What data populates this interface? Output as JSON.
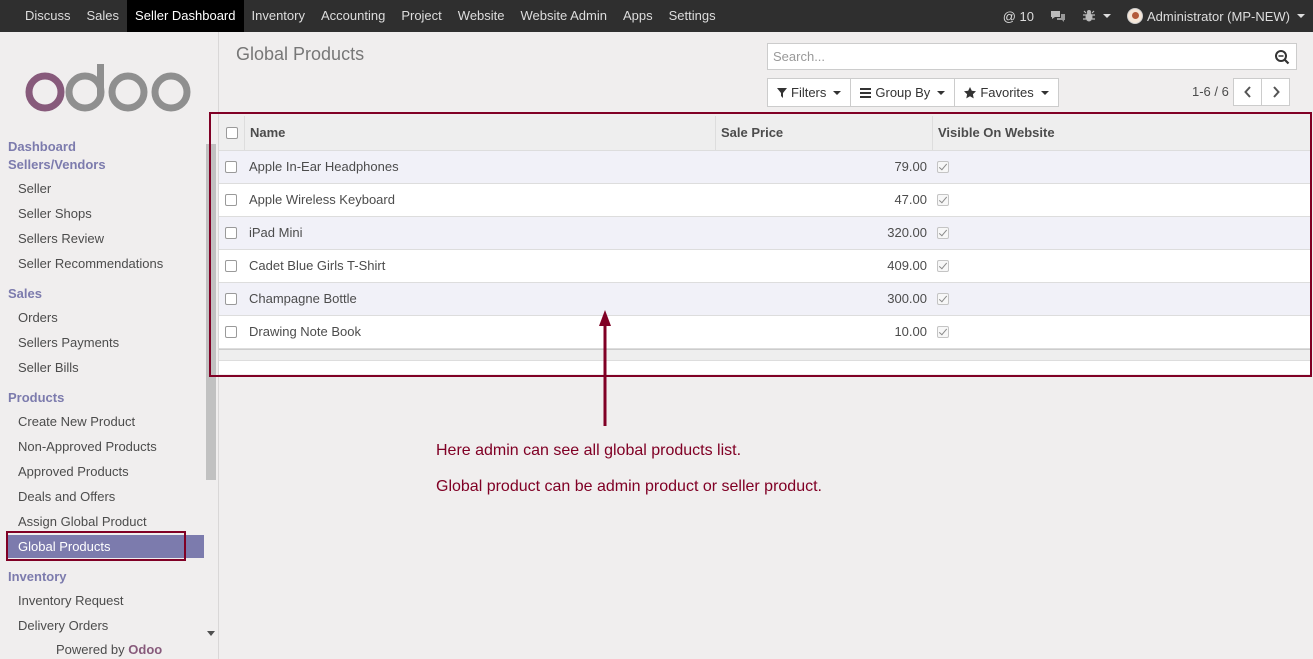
{
  "topbar": {
    "menu": [
      "Discuss",
      "Sales",
      "Seller Dashboard",
      "Inventory",
      "Accounting",
      "Project",
      "Website",
      "Website Admin",
      "Apps",
      "Settings"
    ],
    "active_index": 2,
    "mentions": "@ 10",
    "user": "Administrator (MP-NEW)"
  },
  "sidebar": {
    "logo_text": "odoo",
    "sections": [
      {
        "label": "Dashboard"
      },
      {
        "label": "Sellers/Vendors",
        "items": [
          "Seller",
          "Seller Shops",
          "Sellers Review",
          "Seller Recommendations"
        ]
      },
      {
        "label": "Sales",
        "items": [
          "Orders",
          "Sellers Payments",
          "Seller Bills"
        ]
      },
      {
        "label": "Products",
        "items": [
          "Create New Product",
          "Non-Approved Products",
          "Approved Products",
          "Deals and Offers",
          "Assign Global Product",
          "Global Products"
        ]
      },
      {
        "label": "Inventory",
        "items": [
          "Inventory Request",
          "Delivery Orders"
        ]
      }
    ],
    "powered_prefix": "Powered by",
    "powered_brand": "Odoo"
  },
  "main": {
    "title": "Global Products",
    "search_placeholder": "Search...",
    "filters_label": "Filters",
    "groupby_label": "Group By",
    "favorites_label": "Favorites",
    "pager": "1-6 / 6"
  },
  "table": {
    "columns": [
      "Name",
      "Sale Price",
      "Visible On Website"
    ],
    "rows": [
      {
        "name": "Apple In-Ear Headphones",
        "price": "79.00",
        "visible": true
      },
      {
        "name": "Apple Wireless Keyboard",
        "price": "47.00",
        "visible": true
      },
      {
        "name": "iPad Mini",
        "price": "320.00",
        "visible": true
      },
      {
        "name": "Cadet Blue Girls T-Shirt",
        "price": "409.00",
        "visible": true
      },
      {
        "name": "Champagne Bottle",
        "price": "300.00",
        "visible": true
      },
      {
        "name": "Drawing Note Book",
        "price": "10.00",
        "visible": true
      }
    ]
  },
  "annotation": {
    "line1": "Here admin can see all global products list.",
    "line2": "Global product can be admin product or seller product.",
    "color": "#800025"
  },
  "colors": {
    "brand_purple": "#7c7bad",
    "topbar": "#2f2f2f",
    "logo_o": "#875a7b",
    "logo_doo": "#8f8f8f"
  }
}
